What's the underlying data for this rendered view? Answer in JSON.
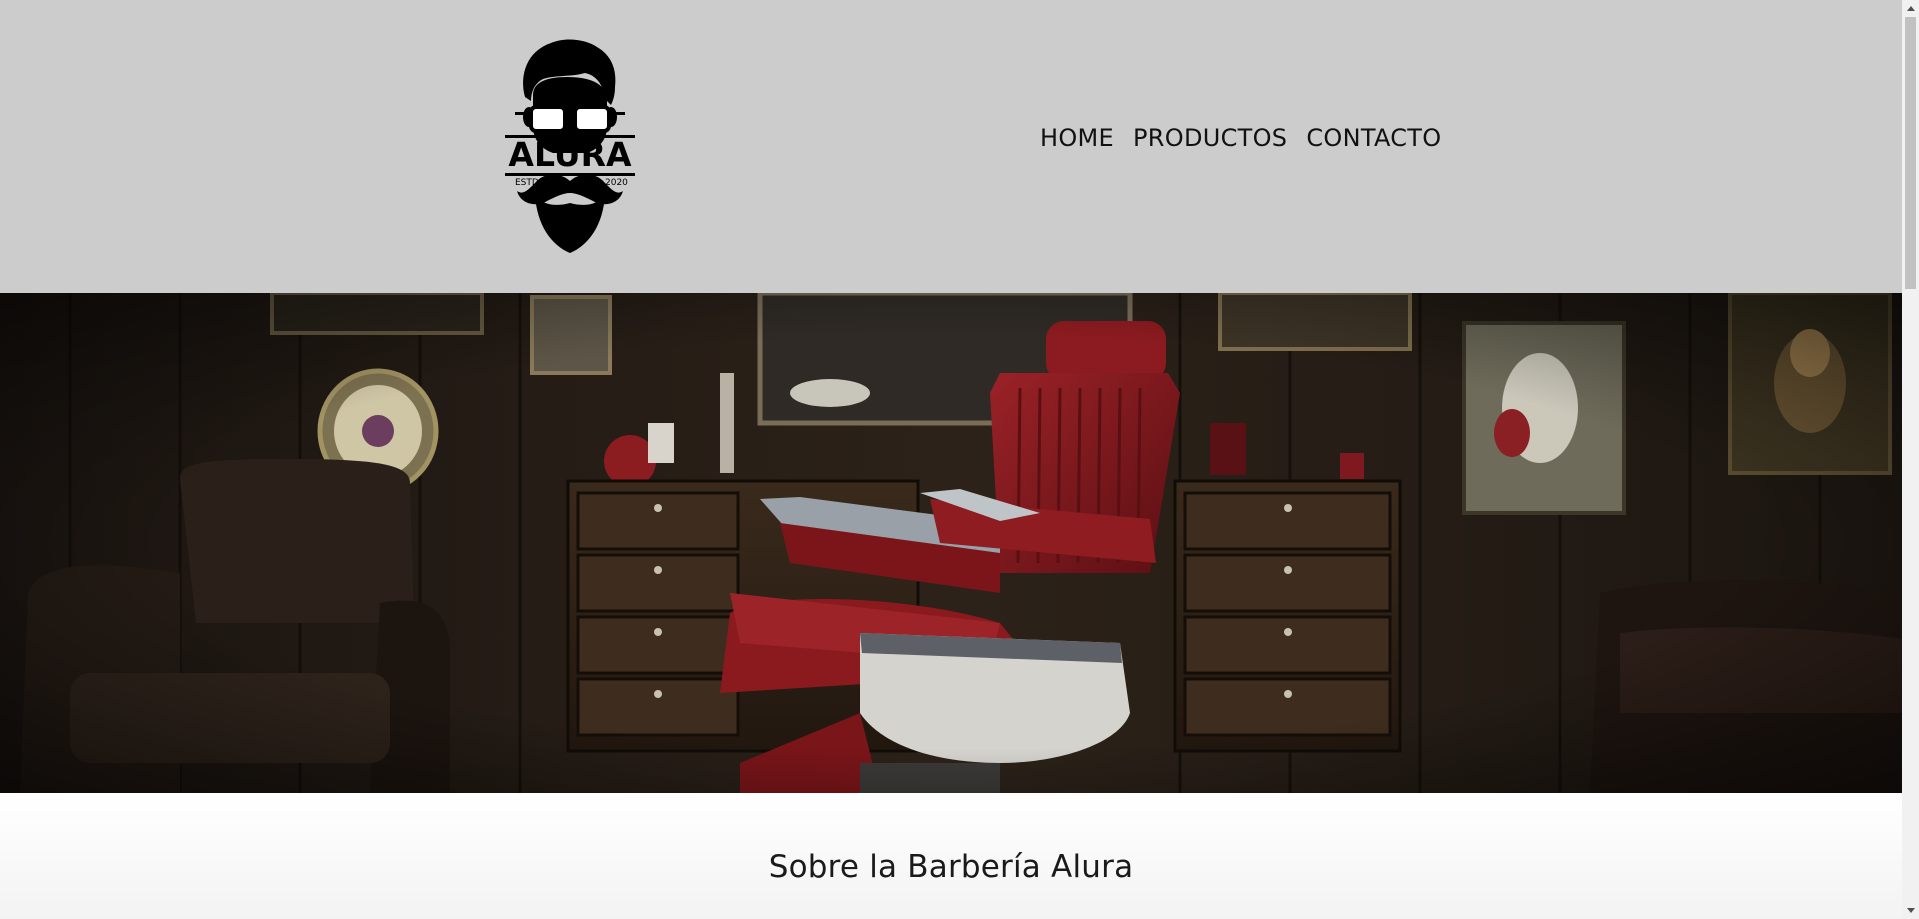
{
  "header": {
    "logo": {
      "brand": "ALURA",
      "left_text": "ESTD",
      "right_text": "2020",
      "icon": "bearded-man-with-glasses-icon"
    },
    "nav": [
      {
        "label": "HOME"
      },
      {
        "label": "PRODUCTOS"
      },
      {
        "label": "CONTACTO"
      }
    ]
  },
  "hero": {
    "image": "barbershop-interior-with-red-barber-chair"
  },
  "about": {
    "title": "Sobre la Barbería Alura"
  },
  "colors": {
    "header_bg": "#cccccc",
    "text": "#111111",
    "chair_red": "#7a1518"
  }
}
